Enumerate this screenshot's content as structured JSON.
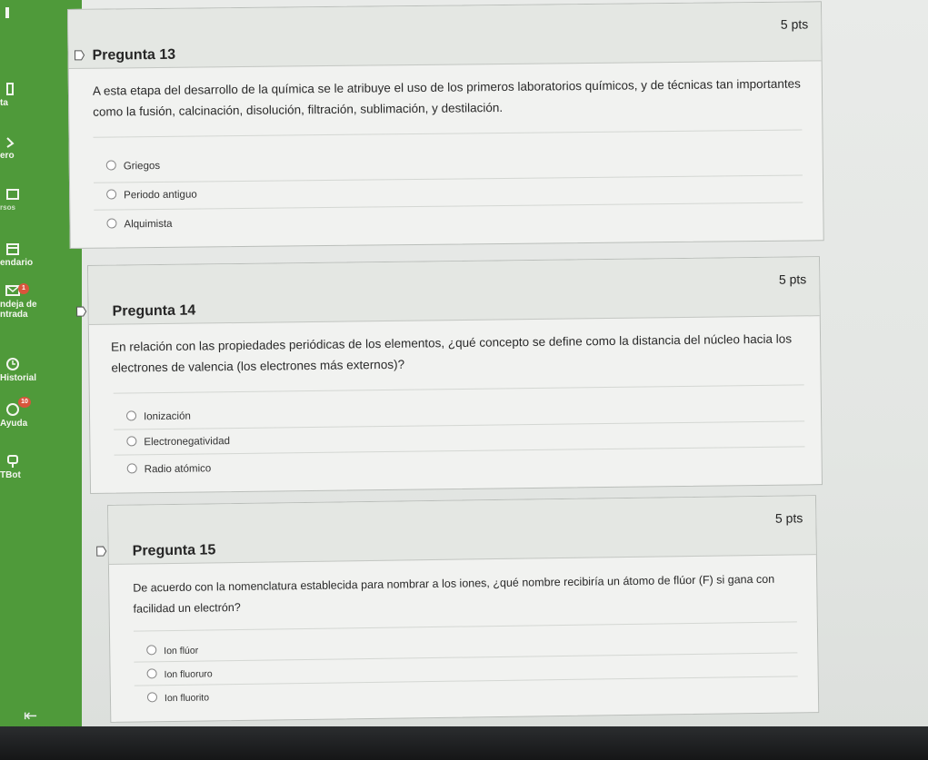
{
  "nav": {
    "items": [
      {
        "label": "ta",
        "icon": "book-icon"
      },
      {
        "label": "ero",
        "icon": "inbox-icon"
      },
      {
        "label": "rsos",
        "icon": "folder-icon"
      },
      {
        "label": "endario",
        "icon": "calendar-icon"
      },
      {
        "label": "ndeja de",
        "label2": "ntrada",
        "icon": "mail-icon",
        "badge": "1"
      },
      {
        "label": "Historial",
        "icon": "clock-icon"
      },
      {
        "label": "Ayuda",
        "icon": "help-icon",
        "badge": "10"
      },
      {
        "label": "TBot",
        "icon": "bot-icon"
      }
    ]
  },
  "questions": [
    {
      "title": "Pregunta 13",
      "points": "5 pts",
      "text_line1": "A esta etapa del desarrollo de la química se le atribuye el uso de los primeros laboratorios químicos, y de técnicas tan importantes",
      "text_line2": "como la fusión, calcinación, disolución, filtración, sublimación, y destilación.",
      "options": [
        "Griegos",
        "Periodo antiguo",
        "Alquimista"
      ]
    },
    {
      "title": "Pregunta 14",
      "points": "5 pts",
      "text_line1": "En relación con las propiedades periódicas de los elementos, ¿qué concepto se define como la distancia del núcleo hacia los",
      "text_line2": "electrones de valencia (los electrones más externos)?",
      "options": [
        "Ionización",
        "Electronegatividad",
        "Radio atómico"
      ]
    },
    {
      "title": "Pregunta 15",
      "points": "5 pts",
      "text_line1": "De acuerdo con la nomenclatura establecida para nombrar a los iones, ¿qué nombre recibiría un átomo de flúor (F) si gana con",
      "text_line2": "facilidad un electrón?",
      "options": [
        "Ion flúor",
        "Ion fluoruro",
        "Ion fluorito"
      ]
    }
  ],
  "colors": {
    "nav_green": "#4f9a3a",
    "badge_red": "#d9553c"
  }
}
